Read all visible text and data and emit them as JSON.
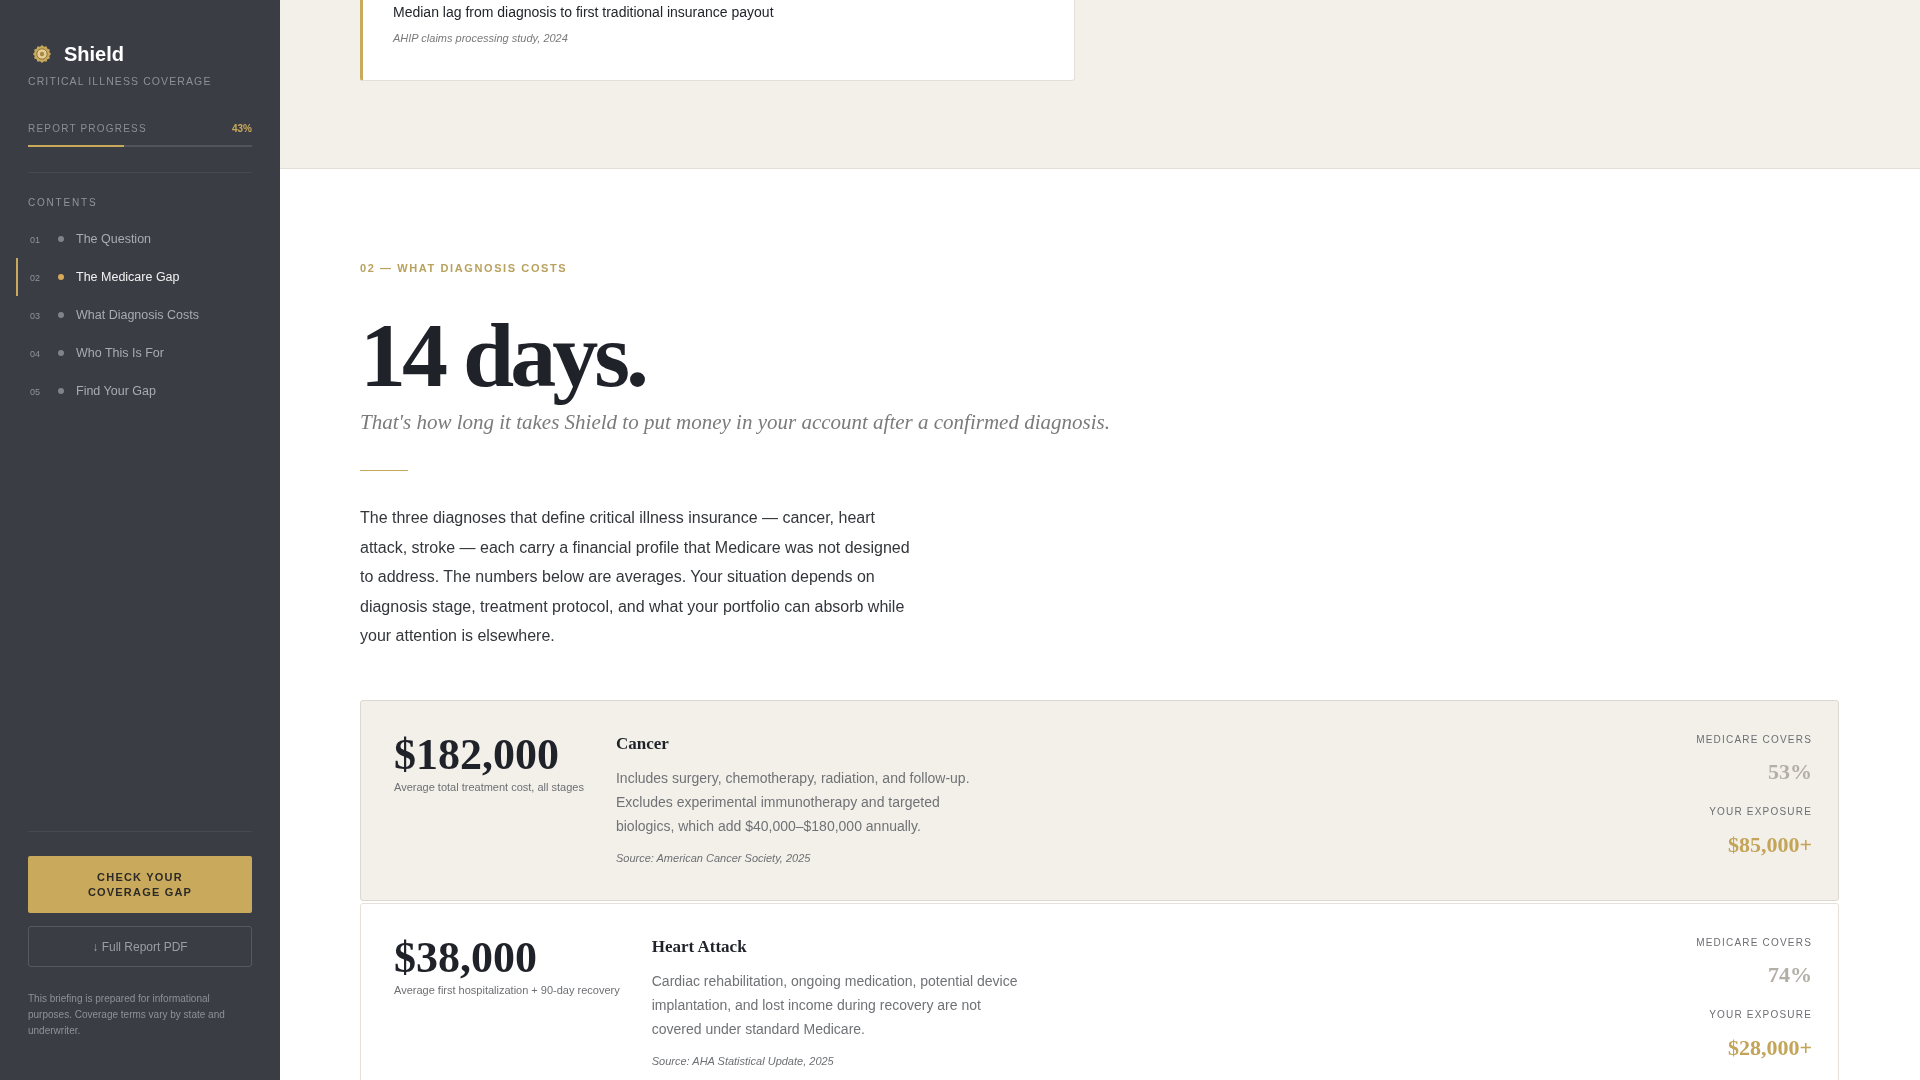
{
  "sidebar": {
    "brand": {
      "name": "Shield",
      "tagline": "CRITICAL ILLNESS COVERAGE"
    },
    "progress": {
      "label": "REPORT PROGRESS",
      "reading": "43%",
      "level": 0.43
    },
    "contents": {
      "heading": "CONTENTS",
      "items": [
        {
          "number": "01",
          "label": "The Question",
          "selected": false
        },
        {
          "number": "02",
          "label": "The Medicare Gap",
          "selected": true
        },
        {
          "number": "03",
          "label": "What Diagnosis Costs",
          "selected": false
        },
        {
          "number": "04",
          "label": "Who This Is For",
          "selected": false
        },
        {
          "number": "05",
          "label": "Find Your Gap",
          "selected": false
        }
      ]
    },
    "cta_button": "CHECK YOUR COVERAGE GAP",
    "pdf_button": "↓ Full Report PDF",
    "disclaimer": "This briefing is prepared for informational purposes. Coverage terms vary by state and underwriter."
  },
  "stat_card": {
    "caption": "Median lag from diagnosis to first traditional insurance payout",
    "source": "AHIP claims processing study, 2024"
  },
  "section": {
    "eyebrow": "02 — WHAT DIAGNOSIS COSTS",
    "headline": "14 days.",
    "subhead": "That's how long it takes Shield to put money in your account after a confirmed diagnosis.",
    "body": "The three diagnoses that define critical illness insurance — cancer, heart attack, stroke — each carry a financial profile that Medicare was not designed to address. The numbers below are averages. Your situation depends on diagnosis stage, treatment protocol, and what your portfolio can absorb while your attention is elsewhere.",
    "cost_cards": [
      {
        "amount": "$182,000",
        "amount_note": "Average total treatment cost, all stages",
        "title": "Cancer",
        "description": "Includes surgery, chemotherapy, radiation, and follow-up. Excludes experimental immunotherapy and targeted biologics, which add $40,000–$180,000 annually.",
        "source": "Source: American Cancer Society, 2025",
        "coverage_label": "MEDICARE COVERS",
        "coverage": "53%",
        "exposure_label": "YOUR EXPOSURE",
        "exposure": "$85,000+",
        "highlighted": true
      },
      {
        "amount": "$38,000",
        "amount_note": "Average first hospitalization + 90-day recovery",
        "title": "Heart Attack",
        "description": "Cardiac rehabilitation, ongoing medication, potential device implantation, and lost income during recovery are not covered under standard Medicare.",
        "source": "Source: AHA Statistical Update, 2025",
        "coverage_label": "MEDICARE COVERS",
        "coverage": "74%",
        "exposure_label": "YOUR EXPOSURE",
        "exposure": "$28,000+",
        "highlighted": false
      }
    ]
  }
}
